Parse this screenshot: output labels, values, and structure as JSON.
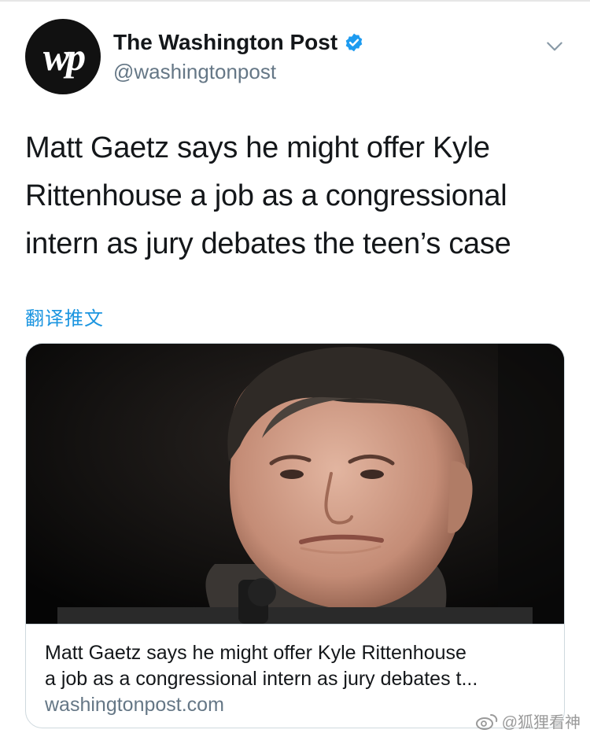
{
  "account": {
    "avatar_text": "wp",
    "display_name": "The Washington Post",
    "handle": "@washingtonpost",
    "verified_icon": "verified-badge-icon",
    "menu_icon": "chevron-down-icon"
  },
  "tweet": {
    "text_lines": [
      "Matt Gaetz says he might offer Kyle",
      "Rittenhouse a job as a congressional",
      "intern as jury debates the teen’s case"
    ],
    "translate_label": "翻译推文"
  },
  "card": {
    "image_subject": "man-portrait-photo",
    "title_lines": [
      "Matt Gaetz says he might offer Kyle Rittenhouse",
      "a job as a congressional intern as jury debates t..."
    ],
    "domain": "washingtonpost.com"
  },
  "watermark": {
    "text": "@狐狸看神"
  },
  "colors": {
    "text_primary": "#14171a",
    "text_secondary": "#657786",
    "link_blue": "#1b95e0",
    "verified_blue": "#1d9bf0",
    "card_border": "#cfd9de"
  }
}
